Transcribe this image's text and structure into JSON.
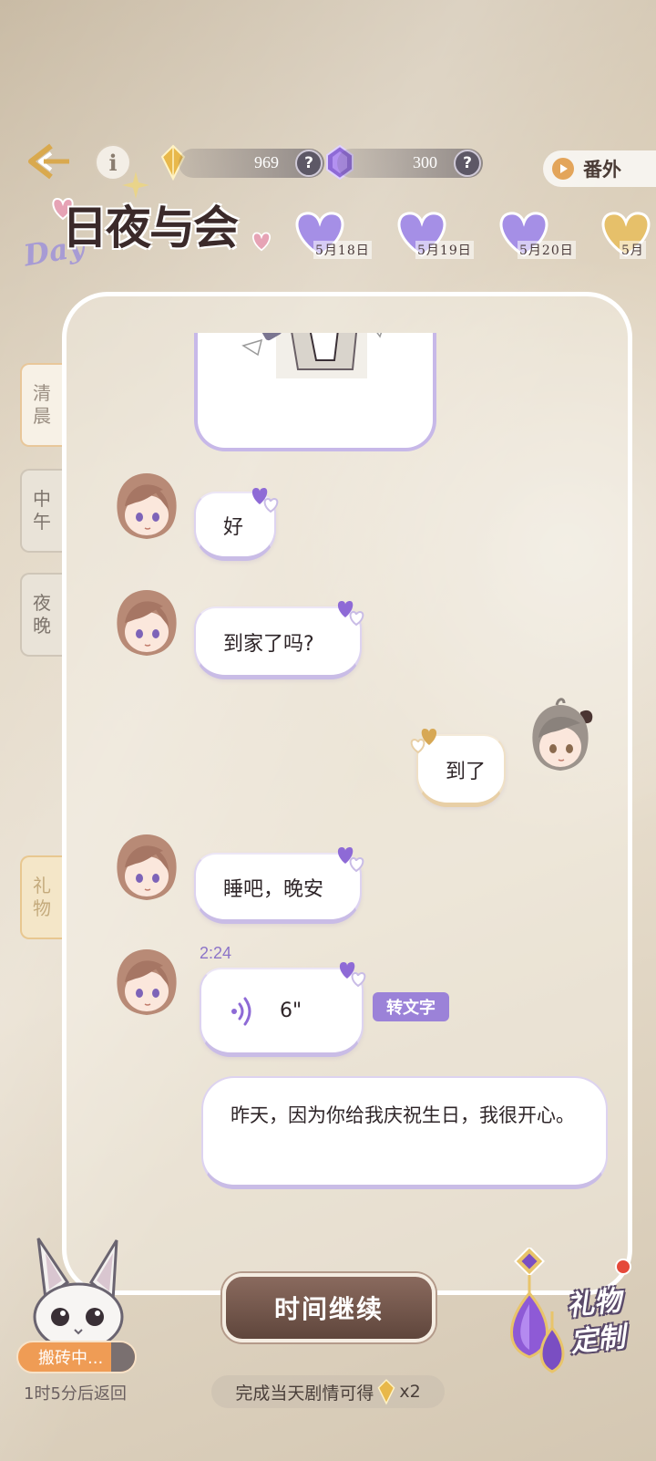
{
  "header": {
    "currency_gold": "969",
    "currency_purple": "300",
    "help_glyph": "?",
    "info_glyph": "i",
    "extra_label": "番外"
  },
  "title": {
    "day": "Day",
    "main": "日夜与会"
  },
  "dates": [
    "5月18日",
    "5月19日",
    "5月20日",
    "5月"
  ],
  "side_tabs": {
    "morning": [
      "清",
      "晨"
    ],
    "noon": [
      "中",
      "午"
    ],
    "night": [
      "夜",
      "晚"
    ],
    "gift": [
      "礼",
      "物"
    ]
  },
  "chat": {
    "messages": [
      {
        "from": "other",
        "text": "好"
      },
      {
        "from": "other",
        "text": "到家了吗?"
      },
      {
        "from": "me",
        "text": "到了"
      },
      {
        "from": "other",
        "text": "睡吧，晚安"
      }
    ],
    "voice": {
      "timestamp": "2:24",
      "duration": "6\"",
      "convert_label": "转文字"
    },
    "transcript": "昨天，因为你给我庆祝生日，我很开心。"
  },
  "bottom": {
    "continue_label": "时间继续",
    "reward_prefix": "完成当天剧情可得",
    "reward_suffix": "x2",
    "bunny_status": "搬砖中...",
    "bunny_timer": "1时5分后返回",
    "gift_custom_line1": "礼物",
    "gift_custom_line2": "定制"
  },
  "colors": {
    "accent_purple": "#9b82d8",
    "bubble_border": "#c9bce6",
    "continue_button": "#6e5246",
    "bunny_status": "#ef9c55"
  }
}
